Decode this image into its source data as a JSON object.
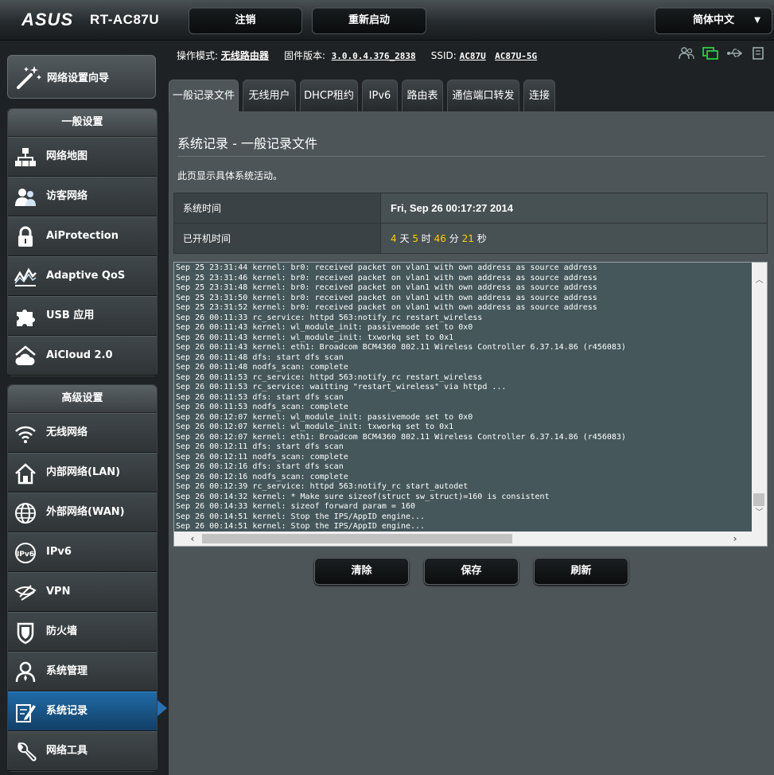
{
  "header": {
    "brand": "ASUS",
    "model": "RT-AC87U",
    "logout_label": "注销",
    "reboot_label": "重新启动",
    "language_label": "简体中文"
  },
  "sidebar": {
    "wizard_label": "网络设置向导",
    "general_title": "一般设置",
    "general_items": [
      {
        "label": "网络地图",
        "icon": "network-map-icon"
      },
      {
        "label": "访客网络",
        "icon": "guest-network-icon"
      },
      {
        "label": "AiProtection",
        "icon": "lock-icon"
      },
      {
        "label": "Adaptive QoS",
        "icon": "qos-icon"
      },
      {
        "label": "USB 应用",
        "icon": "puzzle-icon"
      },
      {
        "label": "AiCloud 2.0",
        "icon": "cloud-icon"
      }
    ],
    "advanced_title": "高级设置",
    "advanced_items": [
      {
        "label": "无线网络",
        "icon": "wifi-icon"
      },
      {
        "label": "内部网络(LAN)",
        "icon": "home-icon"
      },
      {
        "label": "外部网络(WAN)",
        "icon": "globe-icon"
      },
      {
        "label": "IPv6",
        "icon": "ipv6-icon"
      },
      {
        "label": "VPN",
        "icon": "vpn-icon"
      },
      {
        "label": "防火墙",
        "icon": "shield-icon"
      },
      {
        "label": "系统管理",
        "icon": "user-icon"
      },
      {
        "label": "系统记录",
        "icon": "log-edit-icon"
      },
      {
        "label": "网络工具",
        "icon": "wrench-icon"
      }
    ]
  },
  "infobar": {
    "mode_label": "操作模式:",
    "mode_value": "无线路由器",
    "firmware_label": "固件版本:",
    "firmware_value": "3.0.0.4.376_2838",
    "ssid_label": "SSID:",
    "ssid_1": "AC87U",
    "ssid_2": "AC87U-5G"
  },
  "tabs": [
    "一般记录文件",
    "无线用户",
    "DHCP租约",
    "IPv6",
    "路由表",
    "通信端口转发",
    "连接"
  ],
  "main": {
    "title": "系统记录 - 一般记录文件",
    "description": "此页显示具体系统活动。",
    "system_time_label": "系统时间",
    "system_time_value": "Fri, Sep 26 00:17:27 2014",
    "uptime_label": "已开机时间",
    "uptime": {
      "days": "4",
      "days_unit": "天",
      "hours": "5",
      "hours_unit": "时",
      "minutes": "46",
      "minutes_unit": "分",
      "seconds": "21",
      "seconds_unit": "秒"
    },
    "log_lines": [
      "Sep 25 23:31:44 kernel: br0: received packet on vlan1 with own address as source address",
      "Sep 25 23:31:46 kernel: br0: received packet on vlan1 with own address as source address",
      "Sep 25 23:31:48 kernel: br0: received packet on vlan1 with own address as source address",
      "Sep 25 23:31:50 kernel: br0: received packet on vlan1 with own address as source address",
      "Sep 25 23:31:52 kernel: br0: received packet on vlan1 with own address as source address",
      "Sep 26 00:11:33 rc_service: httpd 563:notify_rc restart_wireless",
      "Sep 26 00:11:43 kernel: wl_module_init: passivemode set to 0x0",
      "Sep 26 00:11:43 kernel: wl_module_init: txworkq set to 0x1",
      "Sep 26 00:11:43 kernel: eth1: Broadcom BCM4360 802.11 Wireless Controller 6.37.14.86 (r456083)",
      "Sep 26 00:11:48 dfs: start dfs scan",
      "Sep 26 00:11:48 nodfs_scan: complete",
      "Sep 26 00:11:53 rc_service: httpd 563:notify_rc restart_wireless",
      "Sep 26 00:11:53 rc_service: waitting \"restart_wireless\" via httpd ...",
      "Sep 26 00:11:53 dfs: start dfs scan",
      "Sep 26 00:11:53 nodfs_scan: complete",
      "Sep 26 00:12:07 kernel: wl_module_init: passivemode set to 0x0",
      "Sep 26 00:12:07 kernel: wl_module_init: txworkq set to 0x1",
      "Sep 26 00:12:07 kernel: eth1: Broadcom BCM4360 802.11 Wireless Controller 6.37.14.86 (r456083)",
      "Sep 26 00:12:11 dfs: start dfs scan",
      "Sep 26 00:12:11 nodfs_scan: complete",
      "Sep 26 00:12:16 dfs: start dfs scan",
      "Sep 26 00:12:16 nodfs_scan: complete",
      "Sep 26 00:12:39 rc_service: httpd 563:notify_rc start_autodet",
      "Sep 26 00:14:32 kernel: * Make sure sizeof(struct sw_struct)=160 is consistent",
      "Sep 26 00:14:33 kernel: sizeof forward param = 160",
      "Sep 26 00:14:51 kernel: Stop the IPS/AppID engine...",
      "Sep 26 00:14:51 kernel: Stop the IPS/AppID engine..."
    ],
    "clear_label": "清除",
    "save_label": "保存",
    "refresh_label": "刷新"
  },
  "status_icons": [
    "clients-icon",
    "internet-icon",
    "usb-icon",
    "printer-icon"
  ],
  "colors": {
    "accent_active": "#1f6aa6",
    "highlight": "#ffcc00",
    "content_bg": "#4d5558"
  }
}
